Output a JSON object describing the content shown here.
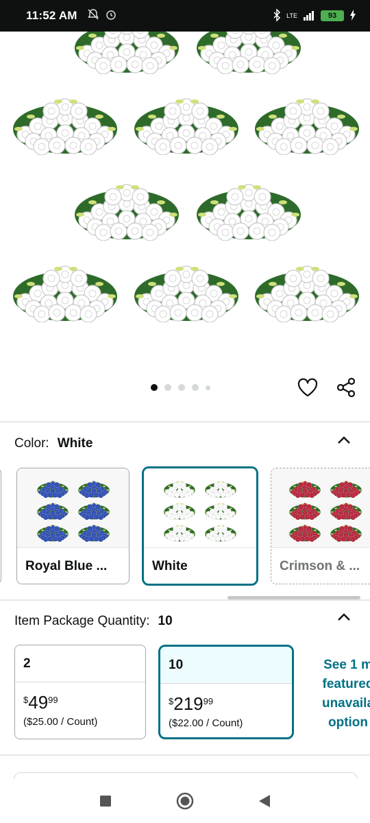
{
  "status_bar": {
    "time": "11:52 AM",
    "network": "LTE",
    "battery": "93",
    "left_icons": [
      "mute-alarm-icon",
      "alarm-icon"
    ],
    "right_icons": [
      "bluetooth-icon",
      "signal-icon",
      "battery-icon",
      "charging-icon"
    ]
  },
  "gallery": {
    "image_count": 5,
    "active_index": 0,
    "bouquet_color": "#ffffff",
    "leaf_color": "#2e6b2a"
  },
  "actions": {
    "wishlist_icon": "heart-icon",
    "share_icon": "share-icon"
  },
  "color": {
    "label": "Color:",
    "selected": "White",
    "options": [
      {
        "label": "Royal Blue ...",
        "flower_color": "#1c3fb0",
        "state": "available"
      },
      {
        "label": "White",
        "flower_color": "#ffffff",
        "state": "selected"
      },
      {
        "label": "Crimson & ...",
        "flower_color": "#b3122a",
        "state": "unavailable"
      }
    ]
  },
  "quantity": {
    "label": "Item Package Quantity:",
    "selected": "10",
    "options": [
      {
        "qty": "2",
        "currency": "$",
        "whole": "49",
        "fraction": "99",
        "unit_price": "($25.00 / Count)",
        "state": "available"
      },
      {
        "qty": "10",
        "currency": "$",
        "whole": "219",
        "fraction": "99",
        "unit_price": "($22.00 / Count)",
        "state": "selected"
      }
    ],
    "see_more": [
      "See 1 m",
      "featured",
      "unavaila",
      "option"
    ]
  },
  "nav": {
    "recents_icon": "square-icon",
    "home_icon": "circle-icon",
    "back_icon": "triangle-back-icon"
  }
}
